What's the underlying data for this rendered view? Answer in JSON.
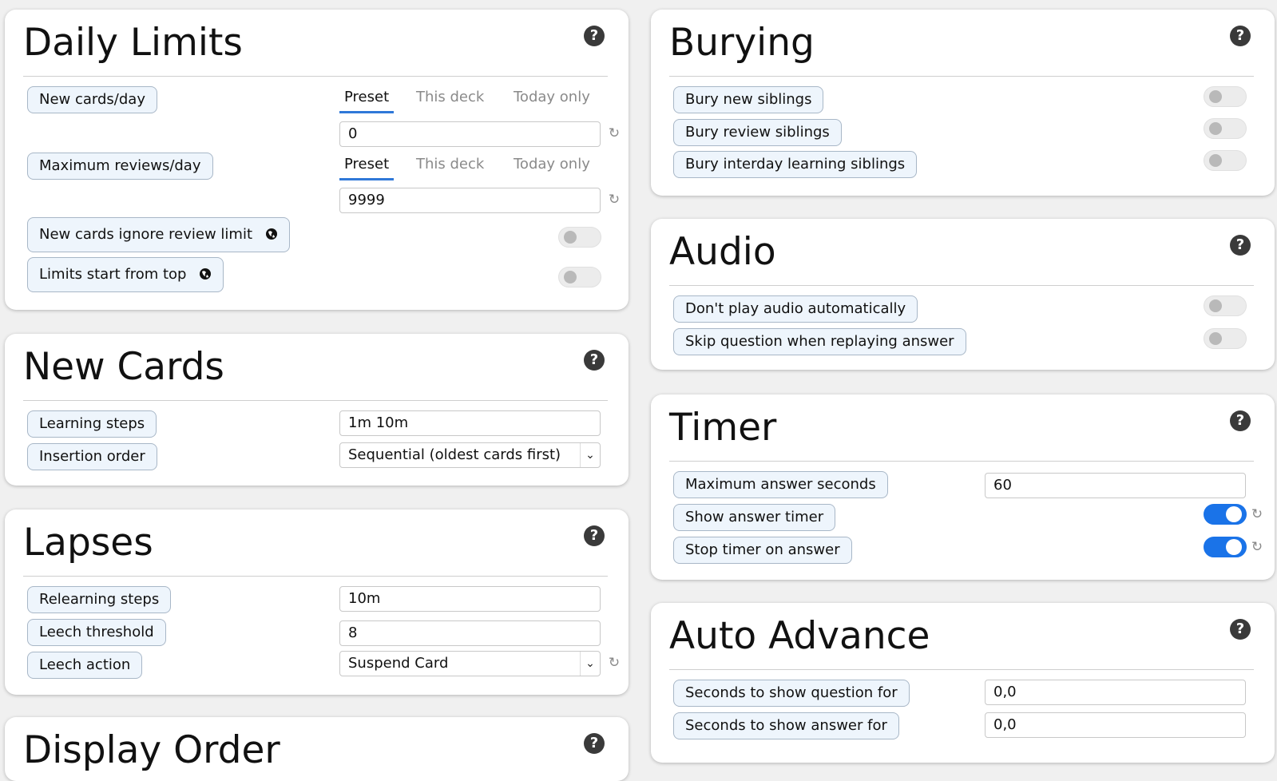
{
  "daily_limits": {
    "title": "Daily Limits",
    "new_cards_day": "New cards/day",
    "max_reviews_day": "Maximum reviews/day",
    "tabs": [
      "Preset",
      "This deck",
      "Today only"
    ],
    "new_cards_value": "0",
    "max_reviews_value": "9999",
    "ignore_review_limit": "New cards ignore review limit",
    "limits_start_top": "Limits start from top"
  },
  "new_cards": {
    "title": "New Cards",
    "learning_steps": "Learning steps",
    "learning_steps_value": "1m 10m",
    "insertion_order": "Insertion order",
    "insertion_order_value": "Sequential (oldest cards first)"
  },
  "lapses": {
    "title": "Lapses",
    "relearning_steps": "Relearning steps",
    "relearning_steps_value": "10m",
    "leech_threshold": "Leech threshold",
    "leech_threshold_value": "8",
    "leech_action": "Leech action",
    "leech_action_value": "Suspend Card"
  },
  "display_order": {
    "title": "Display Order"
  },
  "burying": {
    "title": "Burying",
    "bury_new": "Bury new siblings",
    "bury_review": "Bury review siblings",
    "bury_interday": "Bury interday learning siblings"
  },
  "audio": {
    "title": "Audio",
    "dont_play": "Don't play audio automatically",
    "skip_question": "Skip question when replaying answer"
  },
  "timer": {
    "title": "Timer",
    "max_answer_seconds": "Maximum answer seconds",
    "max_answer_seconds_value": "60",
    "show_answer_timer": "Show answer timer",
    "show_answer_timer_on": true,
    "stop_timer": "Stop timer on answer",
    "stop_timer_on": true
  },
  "auto_advance": {
    "title": "Auto Advance",
    "seconds_question": "Seconds to show question for",
    "seconds_question_value": "0,0",
    "seconds_answer": "Seconds to show answer for",
    "seconds_answer_value": "0,0"
  },
  "icons": {
    "help": "?",
    "revert": "↻",
    "chevron": "⌄"
  },
  "colors": {
    "toggle_on": "#1a73e8",
    "tab_underline": "#2f78d8"
  }
}
